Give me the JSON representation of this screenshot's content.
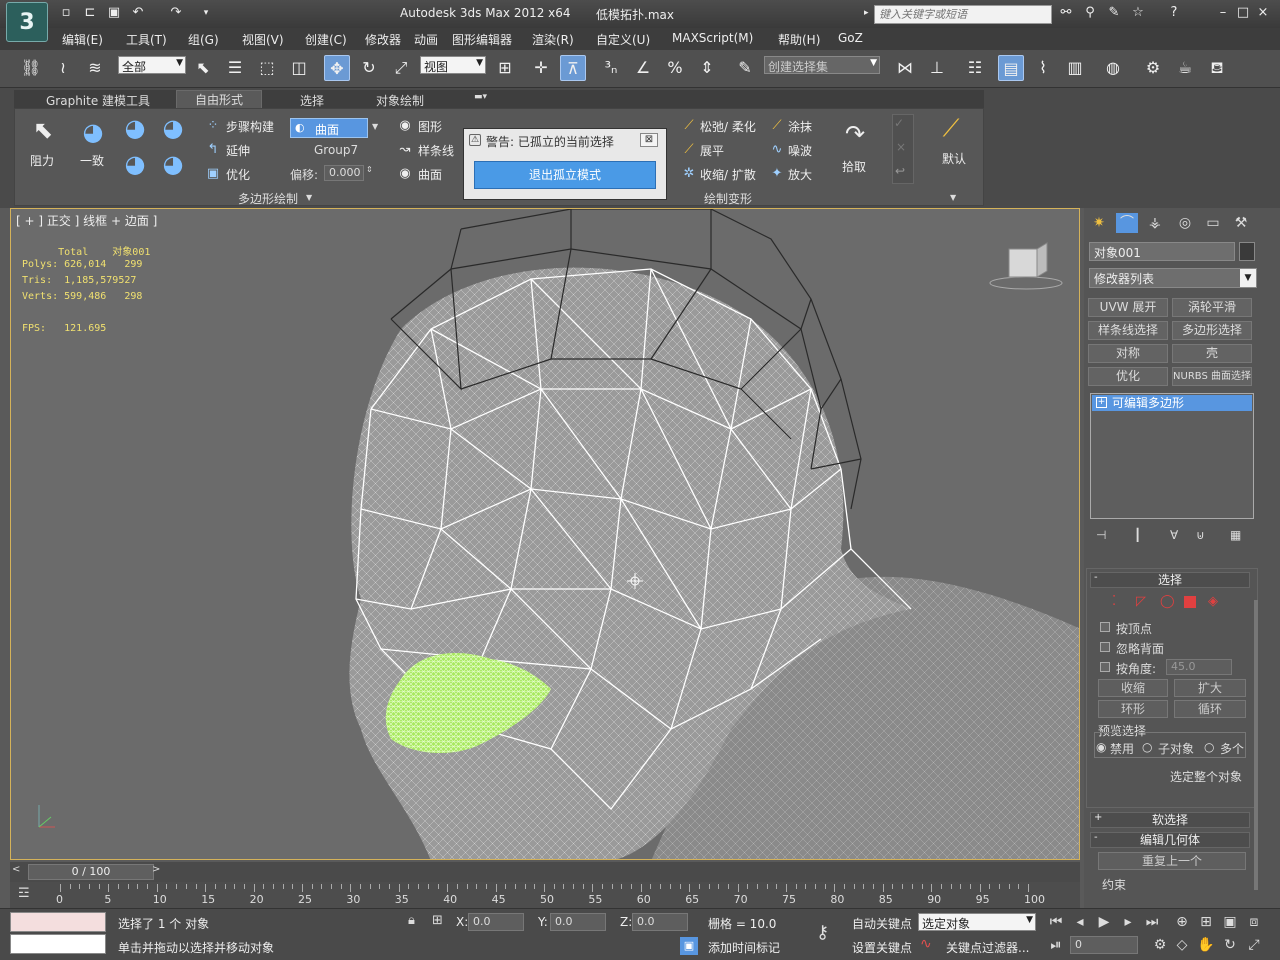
{
  "titlebar": {
    "logo": "3",
    "title": "Autodesk 3ds Max  2012 x64",
    "file": "低模拓扑.max",
    "help_search_placeholder": "键入关键字或短语",
    "minimize": "–",
    "maximize": "□",
    "close": "×"
  },
  "menu": [
    "编辑(E)",
    "工具(T)",
    "组(G)",
    "视图(V)",
    "创建(C)",
    "修改器",
    "动画",
    "图形编辑器",
    "渲染(R)",
    "自定义(U)",
    "MAXScript(M)",
    "帮助(H)",
    "GoZ"
  ],
  "toolbar": {
    "selection_filter": "全部",
    "ref_coord": "视图",
    "named_selection": "创建选择集"
  },
  "ribbon": {
    "tabs": [
      "Graphite 建模工具",
      "自由形式",
      "选择",
      "对象绘制"
    ],
    "active_tab": "自由形式",
    "group1_label": "多边形绘制",
    "group2_label": "绘制变形",
    "drag": "阻力",
    "conform": "一致",
    "step_build": "步骤构建",
    "extend": "延伸",
    "optimize": "优化",
    "surface_dd": "曲面",
    "group_name": "Group7",
    "offset_label": "偏移:",
    "offset_value": "0.000",
    "shape": "图形",
    "spline": "样条线",
    "surface": "曲面",
    "relax_soften": "松弛/ 柔化",
    "flatten": "展平",
    "shrink_expand": "收缩/ 扩散",
    "smudge": "涂抹",
    "noise": "噪波",
    "amplify": "放大",
    "pick": "拾取",
    "default": "默认"
  },
  "warning": {
    "title": "警告: 已孤立的当前选择",
    "button": "退出孤立模式"
  },
  "viewport": {
    "label": "[ + ] 正交 ] 线框 + 边面 ]",
    "stats_header": "      Total    对象001",
    "polys": "Polys: 626,014   299",
    "tris": "Tris:  1,185,579527",
    "verts": "Verts: 599,486   298",
    "fps": "FPS:   121.695"
  },
  "command_panel": {
    "object_name": "对象001",
    "modifier_list": "修改器列表",
    "buttons": [
      "UVW 展开",
      "涡轮平滑",
      "样条线选择",
      "多边形选择",
      "对称",
      "壳",
      "优化",
      "NURBS 曲面选择"
    ],
    "stack_item": "可编辑多边形",
    "selection_rollout": "选择",
    "by_vertex": "按顶点",
    "ignore_backfacing": "忽略背面",
    "by_angle": "按角度:",
    "angle_value": "45.0",
    "shrink": "收缩",
    "grow": "扩大",
    "ring": "环形",
    "loop": "循环",
    "preview_selection": "预览选择",
    "disabled": "禁用",
    "subobject": "子对象",
    "multi": "多个",
    "select_whole": "选定整个对象",
    "soft_selection": "软选择",
    "edit_geometry": "编辑几何体",
    "repeat_last": "重复上一个",
    "constraints": "约束"
  },
  "timeline": {
    "frame": "0 / 100",
    "ticks": [
      "0",
      "5",
      "10",
      "15",
      "20",
      "25",
      "30",
      "35",
      "40",
      "45",
      "50",
      "55",
      "60",
      "65",
      "70",
      "75",
      "80",
      "85",
      "90",
      "95",
      "100"
    ]
  },
  "status": {
    "selected": "选择了 1 个 对象",
    "prompt": "单击并拖动以选择并移动对象",
    "x_label": "X:",
    "x_value": "0.0",
    "y_label": "Y:",
    "y_value": "0.0",
    "z_label": "Z:",
    "z_value": "0.0",
    "grid": "栅格 = 10.0",
    "add_time_tag": "添加时间标记",
    "auto_key": "自动关键点",
    "set_key": "设置关键点",
    "selected_object": "选定对象",
    "key_filter": "关键点过滤器...",
    "current_frame": "0"
  },
  "colors": {
    "accent": "#5896e0",
    "viewport_border": "#d4b25a",
    "stats_text": "#f0e070",
    "selection_mesh": "#a8e860"
  }
}
